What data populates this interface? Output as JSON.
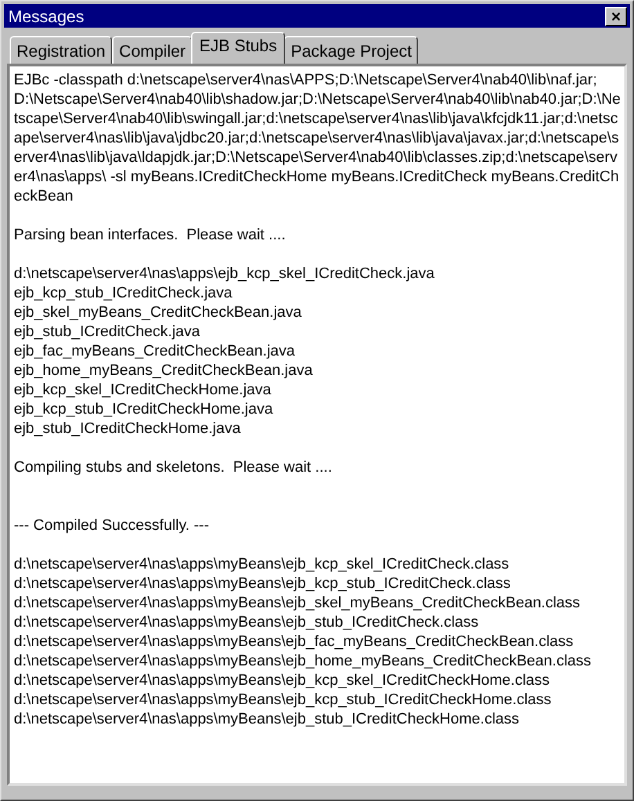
{
  "window": {
    "title": "Messages",
    "close_label": "×"
  },
  "tabs": [
    {
      "label": "Registration",
      "selected": false
    },
    {
      "label": "Compiler",
      "selected": false
    },
    {
      "label": "EJB Stubs",
      "selected": true
    },
    {
      "label": "Package Project",
      "selected": false
    }
  ],
  "log": [
    {
      "kind": "command",
      "lines": [
        "EJBc -classpath d:\\netscape\\server4\\nas\\APPS;D:\\Netscape\\Server4\\nab40\\lib\\naf.jar;D:\\Netscape\\Server4\\nab40\\lib\\shadow.jar;D:\\Netscape\\Server4\\nab40\\lib\\nab40.jar;D:\\Netscape\\Server4\\nab40\\lib\\swingall.jar;d:\\netscape\\server4\\nas\\lib\\java\\kfcjdk11.jar;d:\\netscape\\server4\\nas\\lib\\java\\jdbc20.jar;d:\\netscape\\server4\\nas\\lib\\java\\javax.jar;d:\\netscape\\server4\\nas\\lib\\java\\ldapjdk.jar;D:\\Netscape\\Server4\\nab40\\lib\\classes.zip;d:\\netscape\\server4\\nas\\apps\\ -sl myBeans.ICreditCheckHome myBeans.ICreditCheck myBeans.CreditCheckBean"
      ]
    },
    {
      "kind": "status",
      "lines": [
        "Parsing bean interfaces.  Please wait ...."
      ]
    },
    {
      "kind": "files",
      "lines": [
        "d:\\netscape\\server4\\nas\\apps\\ejb_kcp_skel_ICreditCheck.java",
        "ejb_kcp_stub_ICreditCheck.java",
        "ejb_skel_myBeans_CreditCheckBean.java",
        "ejb_stub_ICreditCheck.java",
        "ejb_fac_myBeans_CreditCheckBean.java",
        "ejb_home_myBeans_CreditCheckBean.java",
        "ejb_kcp_skel_ICreditCheckHome.java",
        "ejb_kcp_stub_ICreditCheckHome.java",
        "ejb_stub_ICreditCheckHome.java"
      ]
    },
    {
      "kind": "status",
      "lines": [
        "Compiling stubs and skeletons.  Please wait ...."
      ]
    },
    {
      "kind": "result",
      "lines": [
        "--- Compiled Successfully. ---"
      ]
    },
    {
      "kind": "files",
      "lines": [
        "d:\\netscape\\server4\\nas\\apps\\myBeans\\ejb_kcp_skel_ICreditCheck.class",
        "d:\\netscape\\server4\\nas\\apps\\myBeans\\ejb_kcp_stub_ICreditCheck.class",
        "d:\\netscape\\server4\\nas\\apps\\myBeans\\ejb_skel_myBeans_CreditCheckBean.class",
        "d:\\netscape\\server4\\nas\\apps\\myBeans\\ejb_stub_ICreditCheck.class",
        "d:\\netscape\\server4\\nas\\apps\\myBeans\\ejb_fac_myBeans_CreditCheckBean.class",
        "d:\\netscape\\server4\\nas\\apps\\myBeans\\ejb_home_myBeans_CreditCheckBean.class",
        "d:\\netscape\\server4\\nas\\apps\\myBeans\\ejb_kcp_skel_ICreditCheckHome.class",
        "d:\\netscape\\server4\\nas\\apps\\myBeans\\ejb_kcp_stub_ICreditCheckHome.class",
        "d:\\netscape\\server4\\nas\\apps\\myBeans\\ejb_stub_ICreditCheckHome.class"
      ]
    }
  ]
}
